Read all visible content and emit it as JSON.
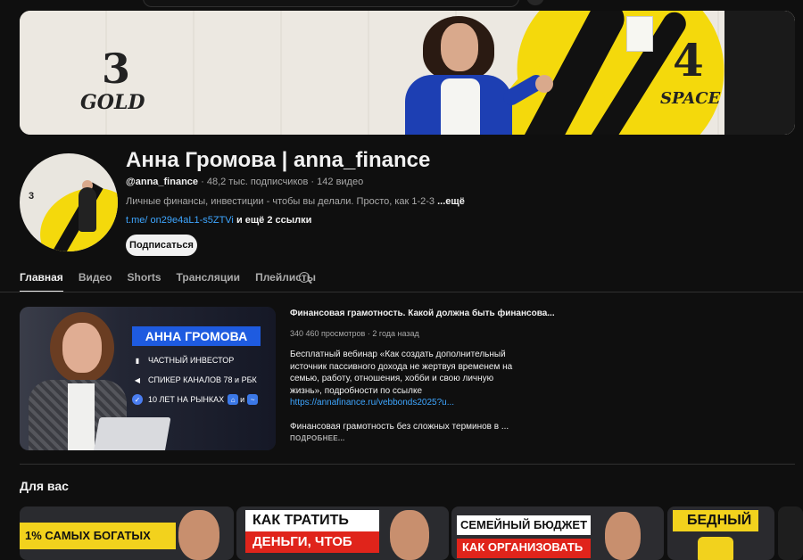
{
  "banner": {
    "left_number": "3",
    "left_word": "GOLD",
    "right_number": "4",
    "right_word": "SPACE"
  },
  "avatar": {
    "mini_text": "3"
  },
  "channel": {
    "title": "Анна Громова | anna_finance",
    "handle": "@anna_finance",
    "subscribers": "48,2 тыс. подписчиков",
    "videos": "142 видео",
    "separator": "·",
    "description": "Личные финансы, инвестиции - чтобы вы делали. Просто, как 1-2-3 ",
    "description_more": "...ещё",
    "link": "t.me/ on29e4aL1-s5ZTVi",
    "more_links": "и ещё 2 ссылки",
    "subscribe_label": "Подписаться"
  },
  "tabs": [
    "Главная",
    "Видео",
    "Shorts",
    "Трансляции",
    "Плейлисты"
  ],
  "featured": {
    "thumb": {
      "name": "АННА ГРОМОВА",
      "line1": "ЧАСТНЫЙ ИНВЕСТОР",
      "line2": "СПИКЕР КАНАЛОВ 78 и РБК",
      "line3": "10 ЛЕТ НА РЫНКАХ",
      "line3_tail": "и"
    },
    "title": "Финансовая грамотность. Какой должна быть финансова...",
    "views": "340 460 просмотров",
    "age": "2 года назад",
    "description": "Бесплатный вебинар «Как создать дополнительный источник пассивного дохода не жертвуя временем на семью, работу, отношения, хобби и свою личную жизнь», подробности по ссылке",
    "url": "https://annafinance.ru/vebbonds2025?u...",
    "description2": "Финансовая грамотность без сложных терминов в ...",
    "more_label": "ПОДРОБНЕЕ..."
  },
  "for_you": {
    "title": "Для вас",
    "cards": [
      {
        "text": "1% САМЫХ БОГАТЫХ"
      },
      {
        "text1": "КАК ТРАТИТЬ",
        "text2": "ДЕНЬГИ, ЧТОБ"
      },
      {
        "text1": "СЕМЕЙНЫЙ БЮДЖЕТ",
        "text2": "КАК ОРГАНИЗОВАТЬ"
      },
      {
        "text": "БЕДНЫЙ"
      }
    ]
  }
}
